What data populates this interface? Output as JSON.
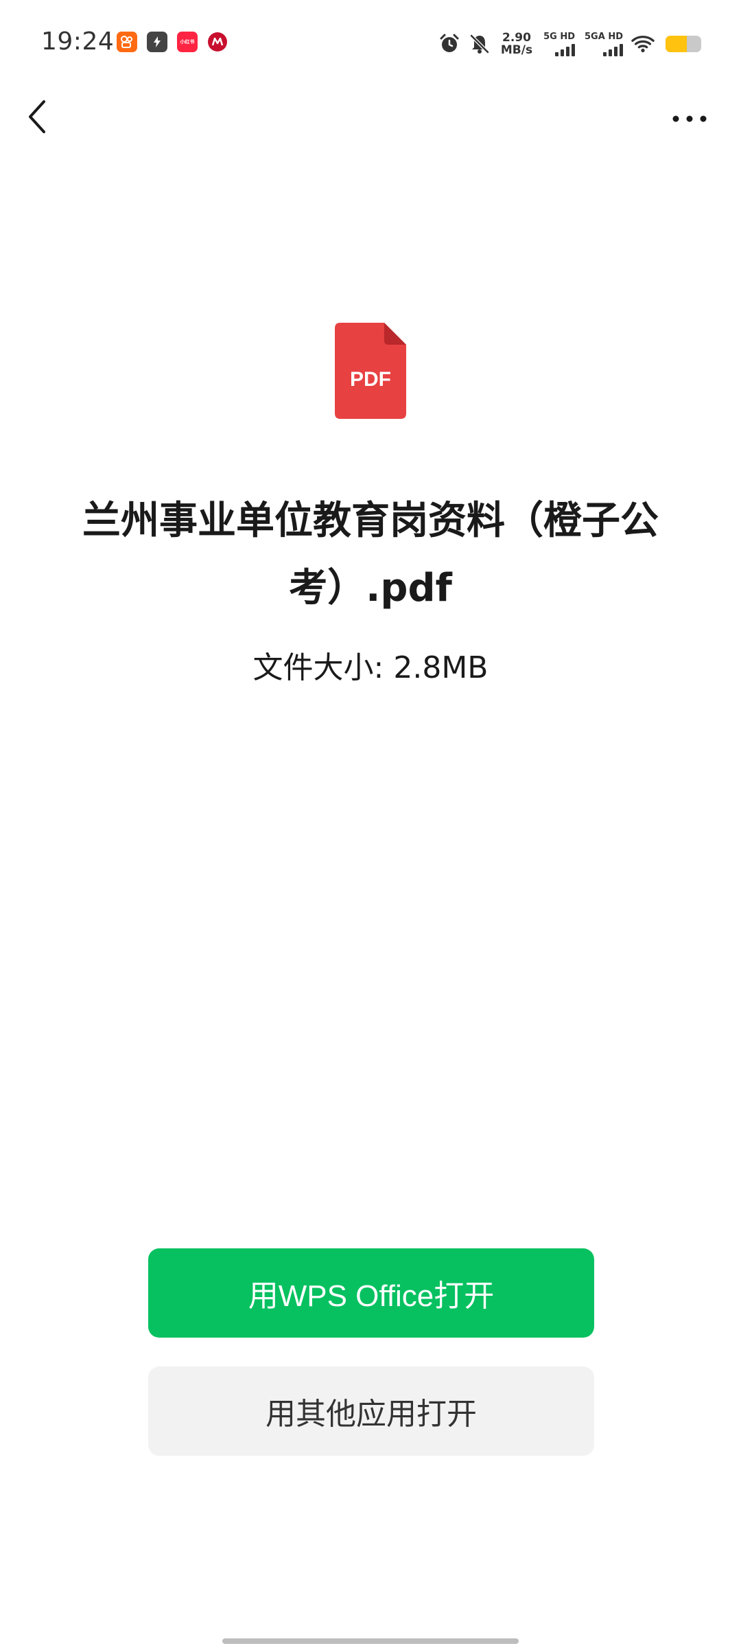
{
  "status_bar": {
    "time": "19:24",
    "notification_icons": [
      "kuaishou-icon",
      "flash-app-icon",
      "xiaohongshu-icon",
      "cmb-bank-icon"
    ],
    "xiaohongshu_label": "小红书",
    "net_speed_value": "2.90",
    "net_speed_unit": "MB/s",
    "signal1_label": "5G HD",
    "signal2_label": "5GA HD",
    "battery_level": 0.6,
    "battery_color": "#ffc20e"
  },
  "nav": {
    "back_icon": "chevron-left-icon",
    "more_icon": "more-horizontal-icon"
  },
  "file": {
    "icon_type": "pdf-file-icon",
    "icon_label": "PDF",
    "icon_color": "#e84142",
    "title": "兰州事业单位教育岗资料（橙子公考）.pdf",
    "size_text": "文件大小: 2.8MB"
  },
  "actions": {
    "primary_label": "用WPS Office打开",
    "primary_color": "#07c160",
    "secondary_label": "用其他应用打开",
    "secondary_color": "#f2f2f2"
  }
}
